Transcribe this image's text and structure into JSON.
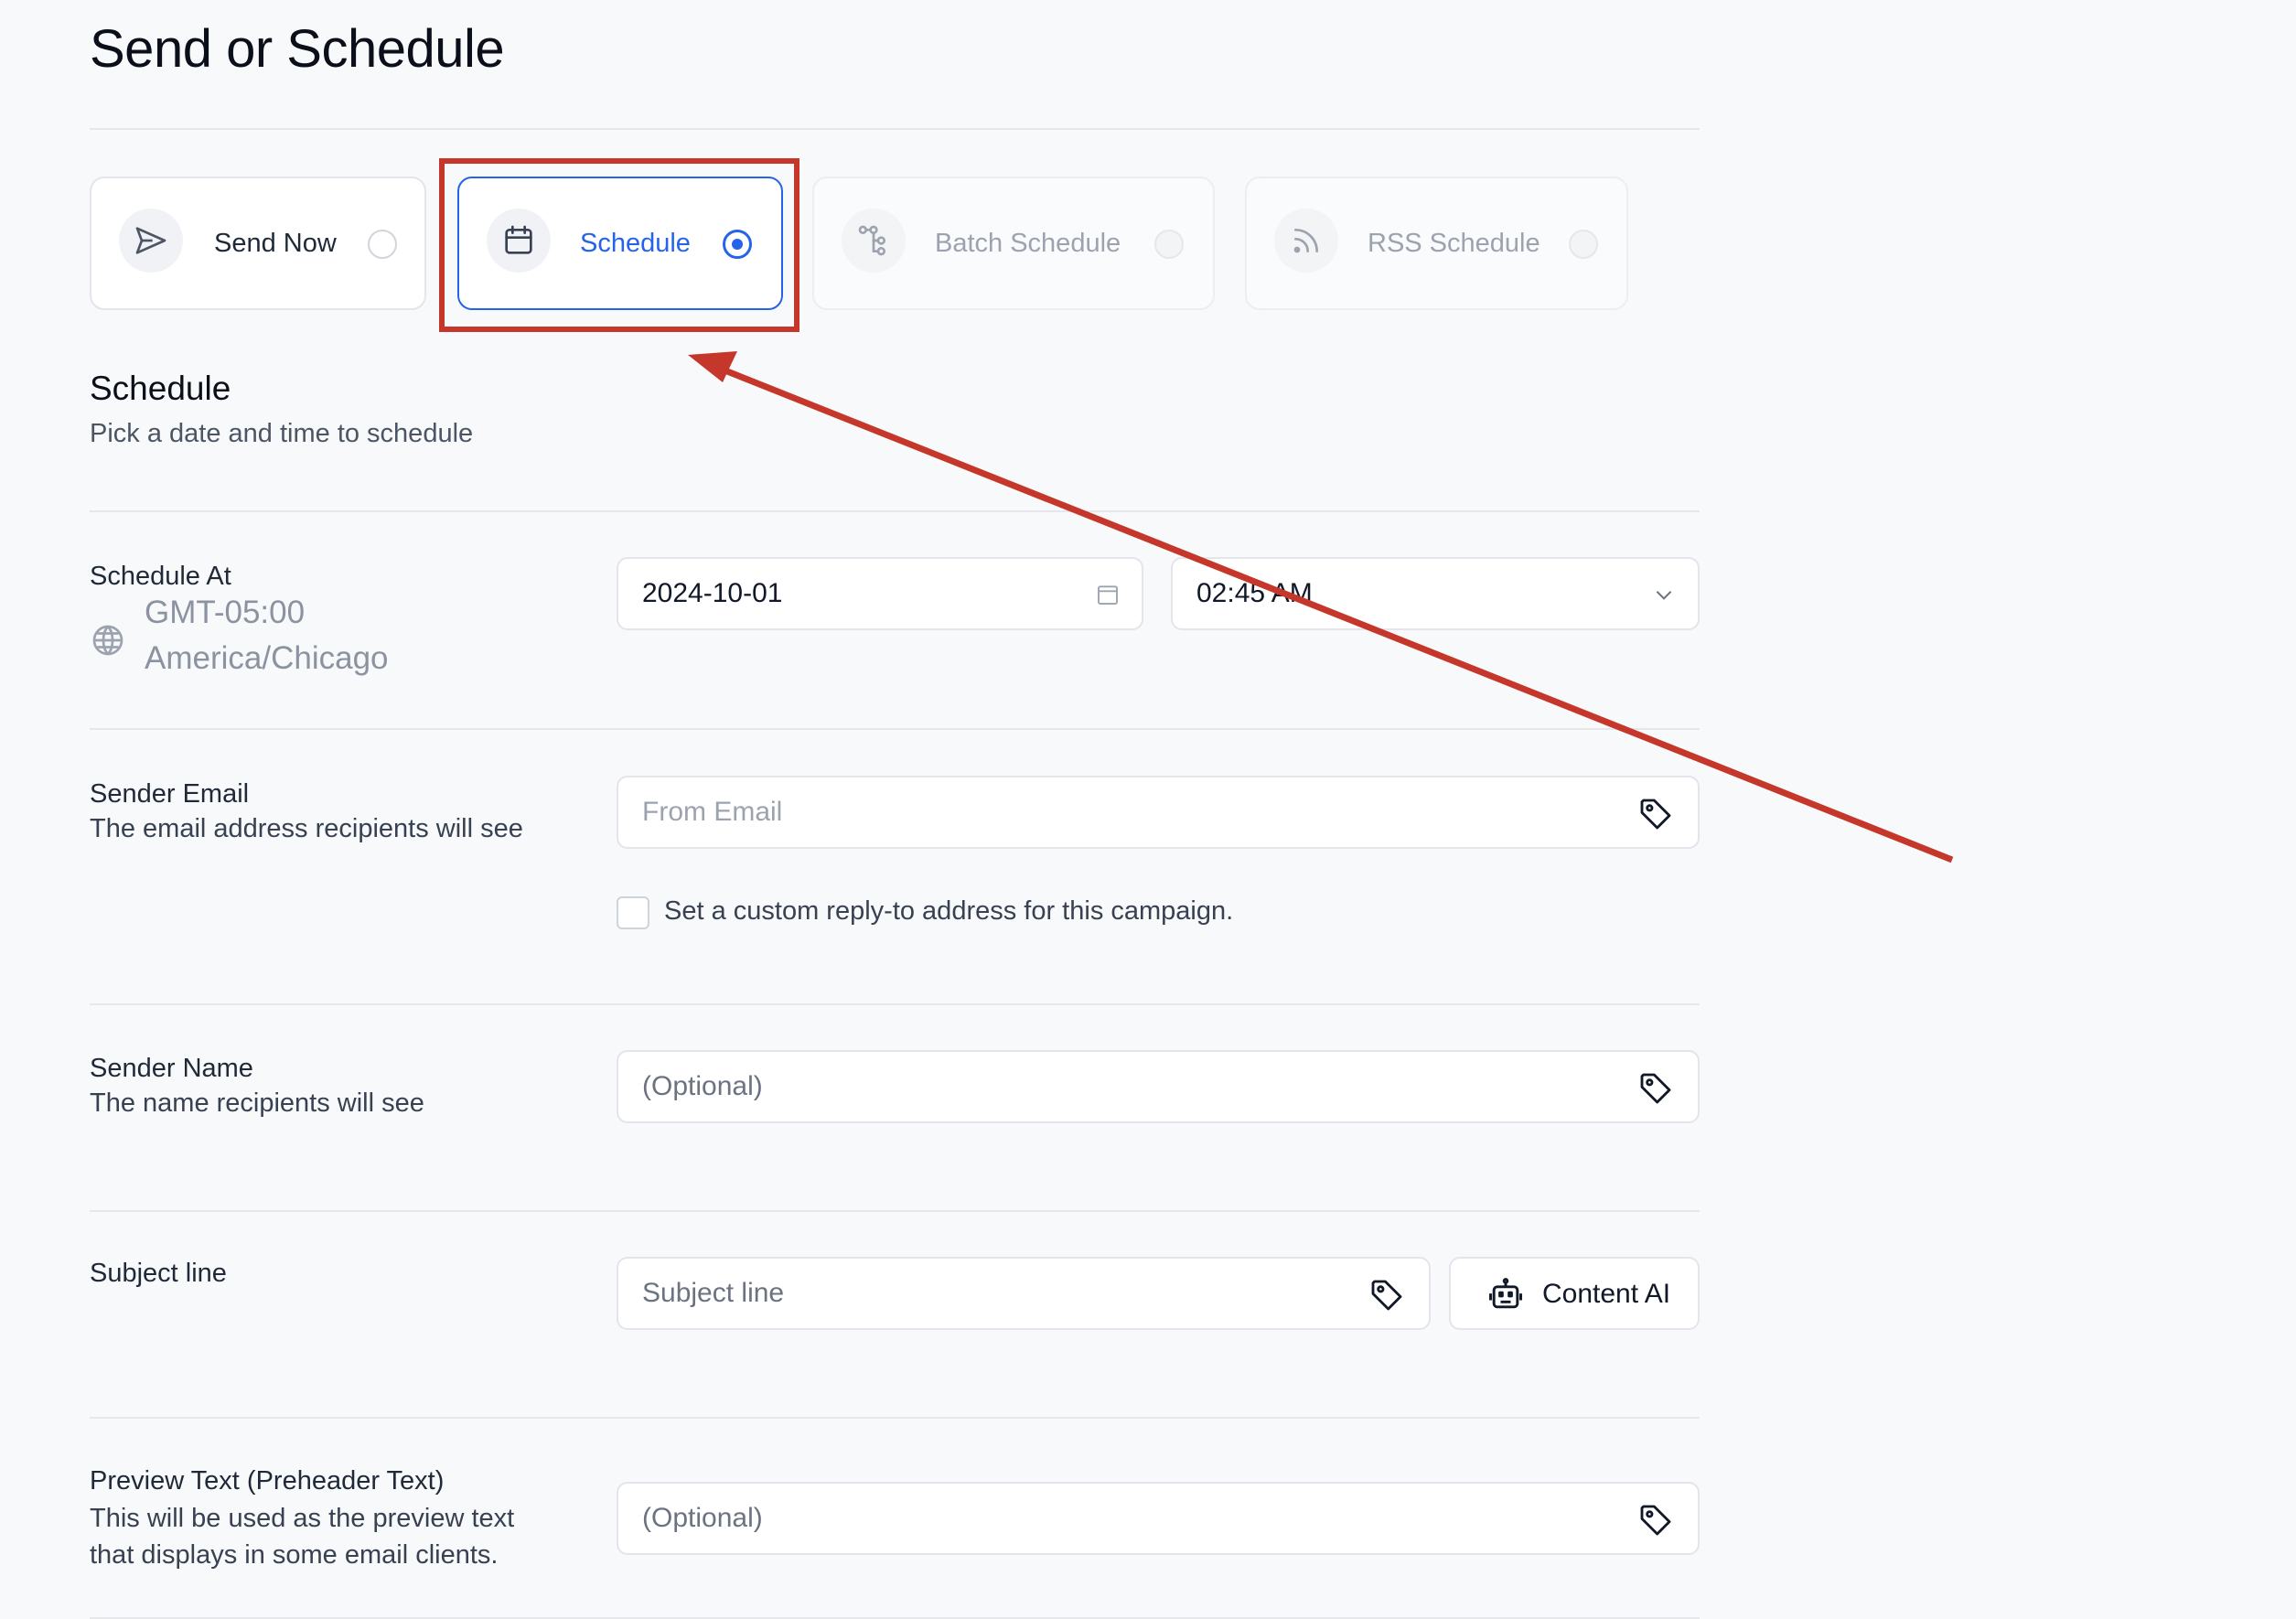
{
  "page": {
    "title": "Send or Schedule"
  },
  "options": [
    {
      "label": "Send Now",
      "icon": "send-icon",
      "state": "available"
    },
    {
      "label": "Schedule",
      "icon": "calendar-icon",
      "state": "selected"
    },
    {
      "label": "Batch Schedule",
      "icon": "tree-icon",
      "state": "disabled"
    },
    {
      "label": "RSS Schedule",
      "icon": "rss-icon",
      "state": "disabled"
    }
  ],
  "schedule_section": {
    "title": "Schedule",
    "subtitle": "Pick a date and time to schedule"
  },
  "schedule_at": {
    "label": "Schedule At",
    "timezone_offset": "GMT-05:00",
    "timezone_name": "America/Chicago",
    "date_value": "2024-10-01",
    "time_value": "02:45 AM"
  },
  "sender_email": {
    "label": "Sender Email",
    "description": "The email address recipients will see",
    "placeholder": "From Email",
    "reply_to_label": "Set a custom reply-to address for this campaign.",
    "reply_to_checked": false
  },
  "sender_name": {
    "label": "Sender Name",
    "description": "The name recipients will see",
    "placeholder": "(Optional)"
  },
  "subject": {
    "label": "Subject line",
    "placeholder": "Subject line",
    "content_ai_label": "Content AI"
  },
  "preview_text": {
    "label": "Preview Text (Preheader Text)",
    "description_line1": "This will be used as the preview text",
    "description_line2": "that displays in some email clients.",
    "placeholder": "(Optional)"
  },
  "colors": {
    "accent": "#2563eb",
    "annotation": "#c4372a"
  }
}
